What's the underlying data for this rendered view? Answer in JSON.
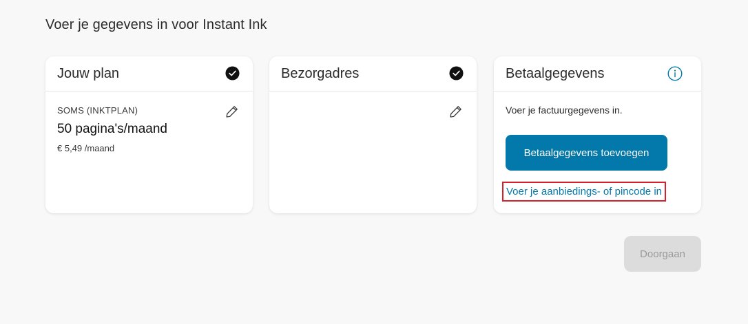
{
  "page": {
    "heading": "Voer je gegevens in voor Instant Ink"
  },
  "plan_card": {
    "title": "Jouw plan",
    "status_icon": "check-circle-icon",
    "edit_icon": "pencil-icon",
    "plan_name": "SOMS (INKTPLAN)",
    "pages": "50 pagina's/maand",
    "price": "€ 5,49 /maand"
  },
  "address_card": {
    "title": "Bezorgadres",
    "status_icon": "check-circle-icon",
    "edit_icon": "pencil-icon"
  },
  "payment_card": {
    "title": "Betaalgegevens",
    "info_icon": "info-icon",
    "description": "Voer je factuurgegevens in.",
    "add_button_label": "Betaalgegevens toevoegen",
    "promo_link": "Voer je aanbiedings- of pincode in"
  },
  "footer": {
    "continue_label": "Doorgaan",
    "continue_enabled": false
  },
  "colors": {
    "accent": "#0278ab",
    "highlight_border": "#d6202a",
    "disabled_button": "#dcdcdc"
  }
}
